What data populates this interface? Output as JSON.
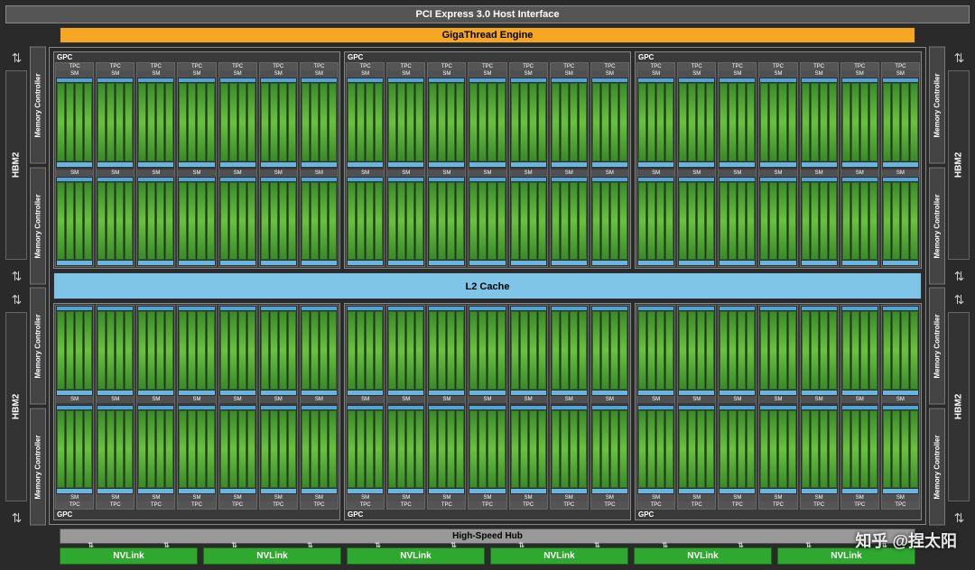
{
  "header": {
    "pci": "PCI Express 3.0 Host Interface",
    "giga": "GigaThread Engine"
  },
  "side": {
    "hbm": "HBM2",
    "memctrl": "Memory Controller",
    "arrows": "⇄"
  },
  "gpc": {
    "label": "GPC",
    "tpc": "TPC",
    "sm": "SM"
  },
  "l2": "L2 Cache",
  "footer": {
    "hub": "High-Speed Hub",
    "nvlink": "NVLink"
  },
  "counts": {
    "gpc_rows": 2,
    "gpc_per_row": 3,
    "tpc_per_gpc": 7,
    "sm_per_tpc": 2,
    "nvlinks": 6,
    "hbm_per_side": 2,
    "memctrl_per_side": 4
  },
  "watermark": "知乎 @捏太阳"
}
